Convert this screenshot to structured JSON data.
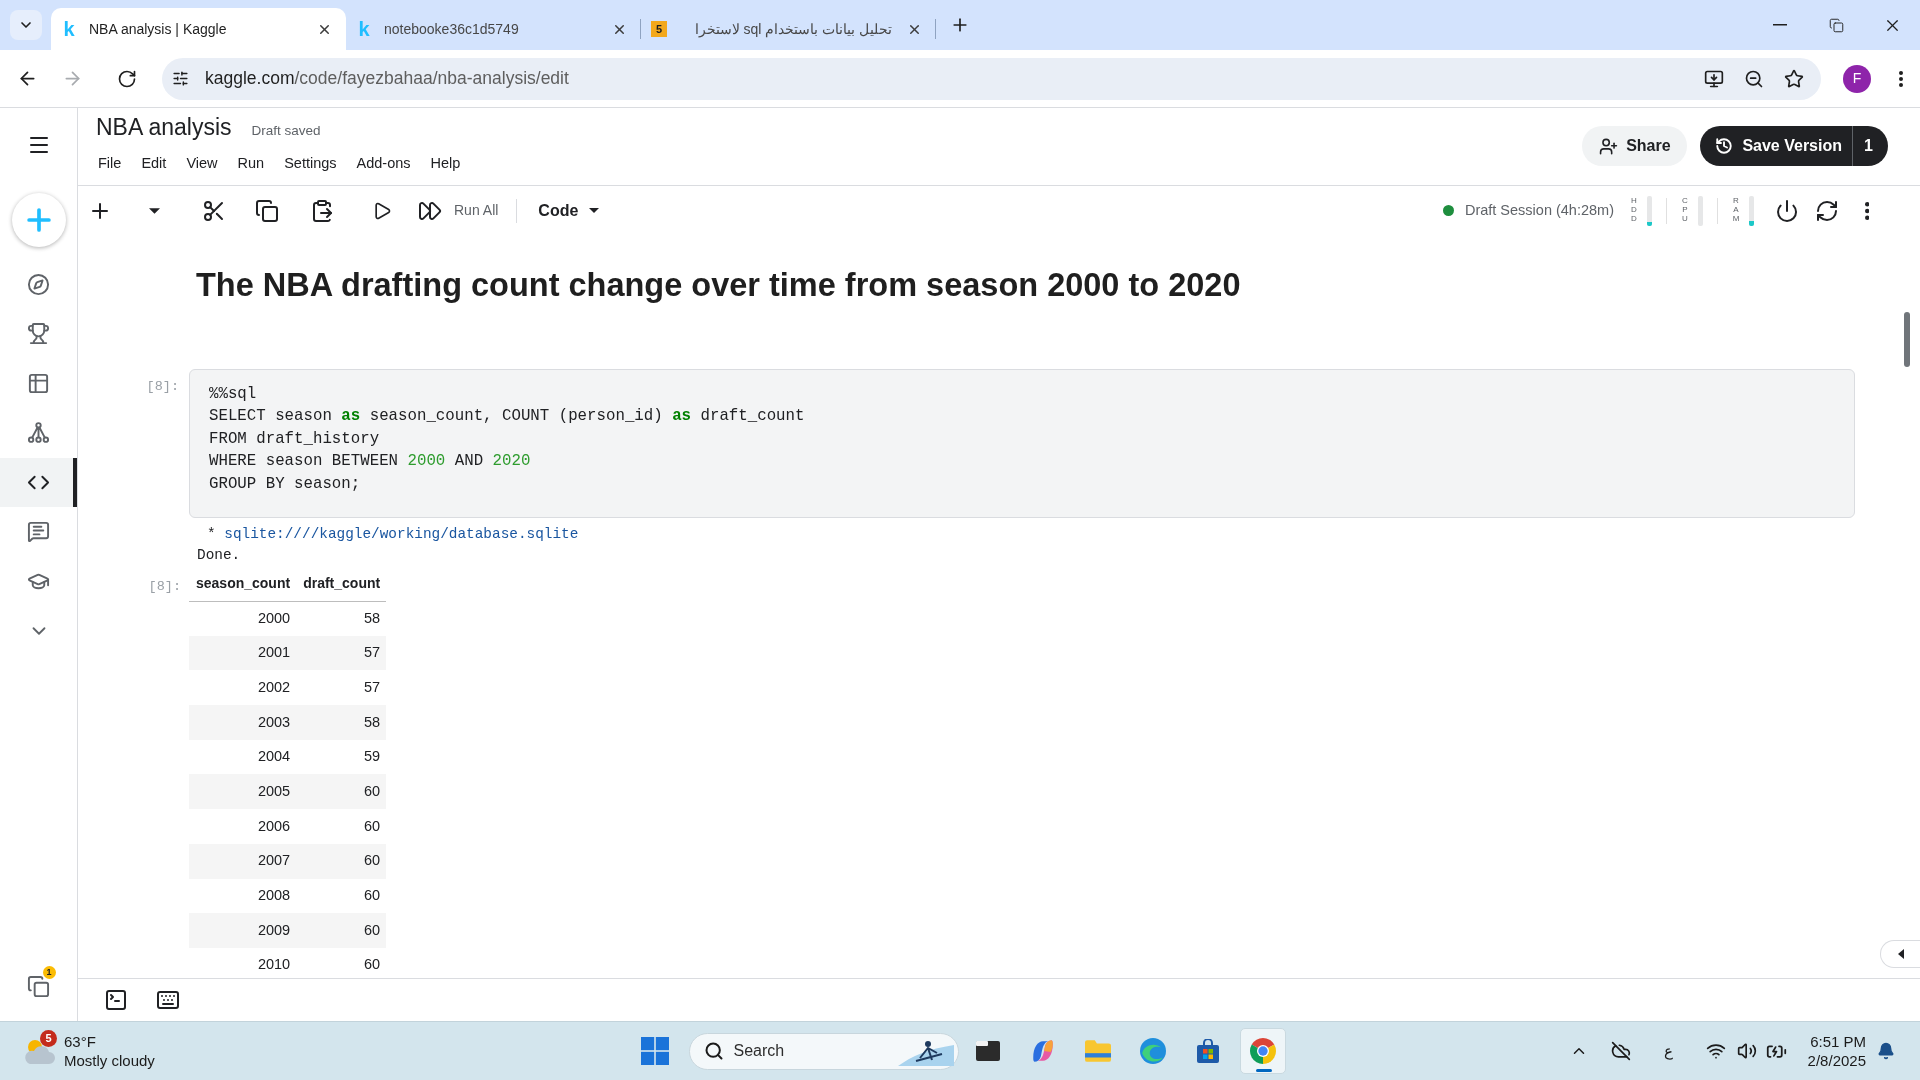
{
  "browser": {
    "tabs": [
      {
        "title": "NBA analysis | Kaggle",
        "selected": true,
        "favicon": {
          "kind": "letter",
          "text": "k"
        }
      },
      {
        "title": "notebooke36c1d5749",
        "selected": false,
        "favicon": {
          "kind": "letter",
          "text": "k"
        }
      },
      {
        "title": "تحليل بيانات باستخدام sql لاستخرا",
        "selected": false,
        "favicon": {
          "kind": "tile",
          "text": "5"
        }
      }
    ],
    "forward_disabled": true,
    "address": {
      "domain": "kaggle.com",
      "path": "/code/fayezbahaa/nba-analysis/edit"
    },
    "profile_initial": "F"
  },
  "sidebar": {
    "items": [
      {
        "selected": false
      },
      {
        "selected": false
      },
      {
        "selected": false
      },
      {
        "selected": false
      },
      {
        "selected": true
      },
      {
        "selected": false
      },
      {
        "selected": false
      }
    ],
    "notification_count": "1"
  },
  "notebook": {
    "title": "NBA analysis",
    "save_status": "Draft saved",
    "menu": [
      "File",
      "Edit",
      "View",
      "Run",
      "Settings",
      "Add-ons",
      "Help"
    ],
    "share_label": "Share",
    "save_version": {
      "label": "Save Version",
      "count": "1"
    }
  },
  "toolbar": {
    "run_all_label": "Run All",
    "cell_type": "Code",
    "session": {
      "label": "Draft Session (4h:28m)",
      "running": true
    },
    "meters": [
      {
        "label": "HDD",
        "level": 0.12
      },
      {
        "label": "CPU"
      },
      {
        "label": "RAM",
        "level": 0.15
      }
    ]
  },
  "cells": [
    {
      "kind": "markdown",
      "heading": "The NBA drafting count change over time from season 2000 to 2020"
    },
    {
      "kind": "code",
      "prompt": "[8]:",
      "lines": [
        [
          {
            "kind": "plain",
            "text": "%%sql"
          }
        ],
        [
          {
            "kind": "plain",
            "text": "SELECT season "
          },
          {
            "kind": "keyword",
            "text": "as"
          },
          {
            "kind": "plain",
            "text": " season_count, COUNT (person_id) "
          },
          {
            "kind": "keyword",
            "text": "as"
          },
          {
            "kind": "plain",
            "text": " draft_count"
          }
        ],
        [
          {
            "kind": "plain",
            "text": "FROM draft_history"
          }
        ],
        [
          {
            "kind": "plain",
            "text": "WHERE season BETWEEN "
          },
          {
            "kind": "number",
            "text": "2000"
          },
          {
            "kind": "plain",
            "text": " AND "
          },
          {
            "kind": "number",
            "text": "2020"
          }
        ],
        [
          {
            "kind": "plain",
            "text": "GROUP BY season;"
          }
        ]
      ],
      "outputs": [
        {
          "kind": "stream",
          "marker": "*",
          "connection": "sqlite:////kaggle/working/database.sqlite",
          "status": "Done."
        },
        {
          "kind": "table",
          "prompt": "[8]:",
          "columns": [
            "season_count",
            "draft_count"
          ],
          "rows": [
            [
              "2000",
              "58"
            ],
            [
              "2001",
              "57"
            ],
            [
              "2002",
              "57"
            ],
            [
              "2003",
              "58"
            ],
            [
              "2004",
              "59"
            ],
            [
              "2005",
              "60"
            ],
            [
              "2006",
              "60"
            ],
            [
              "2007",
              "60"
            ],
            [
              "2008",
              "60"
            ],
            [
              "2009",
              "60"
            ],
            [
              "2010",
              "60"
            ]
          ]
        }
      ]
    }
  ],
  "taskbar": {
    "weather": {
      "alert_count": "5",
      "temperature": "63°F",
      "condition": "Mostly cloudy"
    },
    "search_placeholder": "Search",
    "apps": [
      {
        "selected": false
      },
      {
        "selected": false
      },
      {
        "selected": false
      },
      {
        "selected": false
      },
      {
        "selected": false
      },
      {
        "selected": true
      }
    ],
    "input_language": "ع",
    "clock": {
      "time": "6:51 PM",
      "date": "2/8/2025"
    }
  }
}
